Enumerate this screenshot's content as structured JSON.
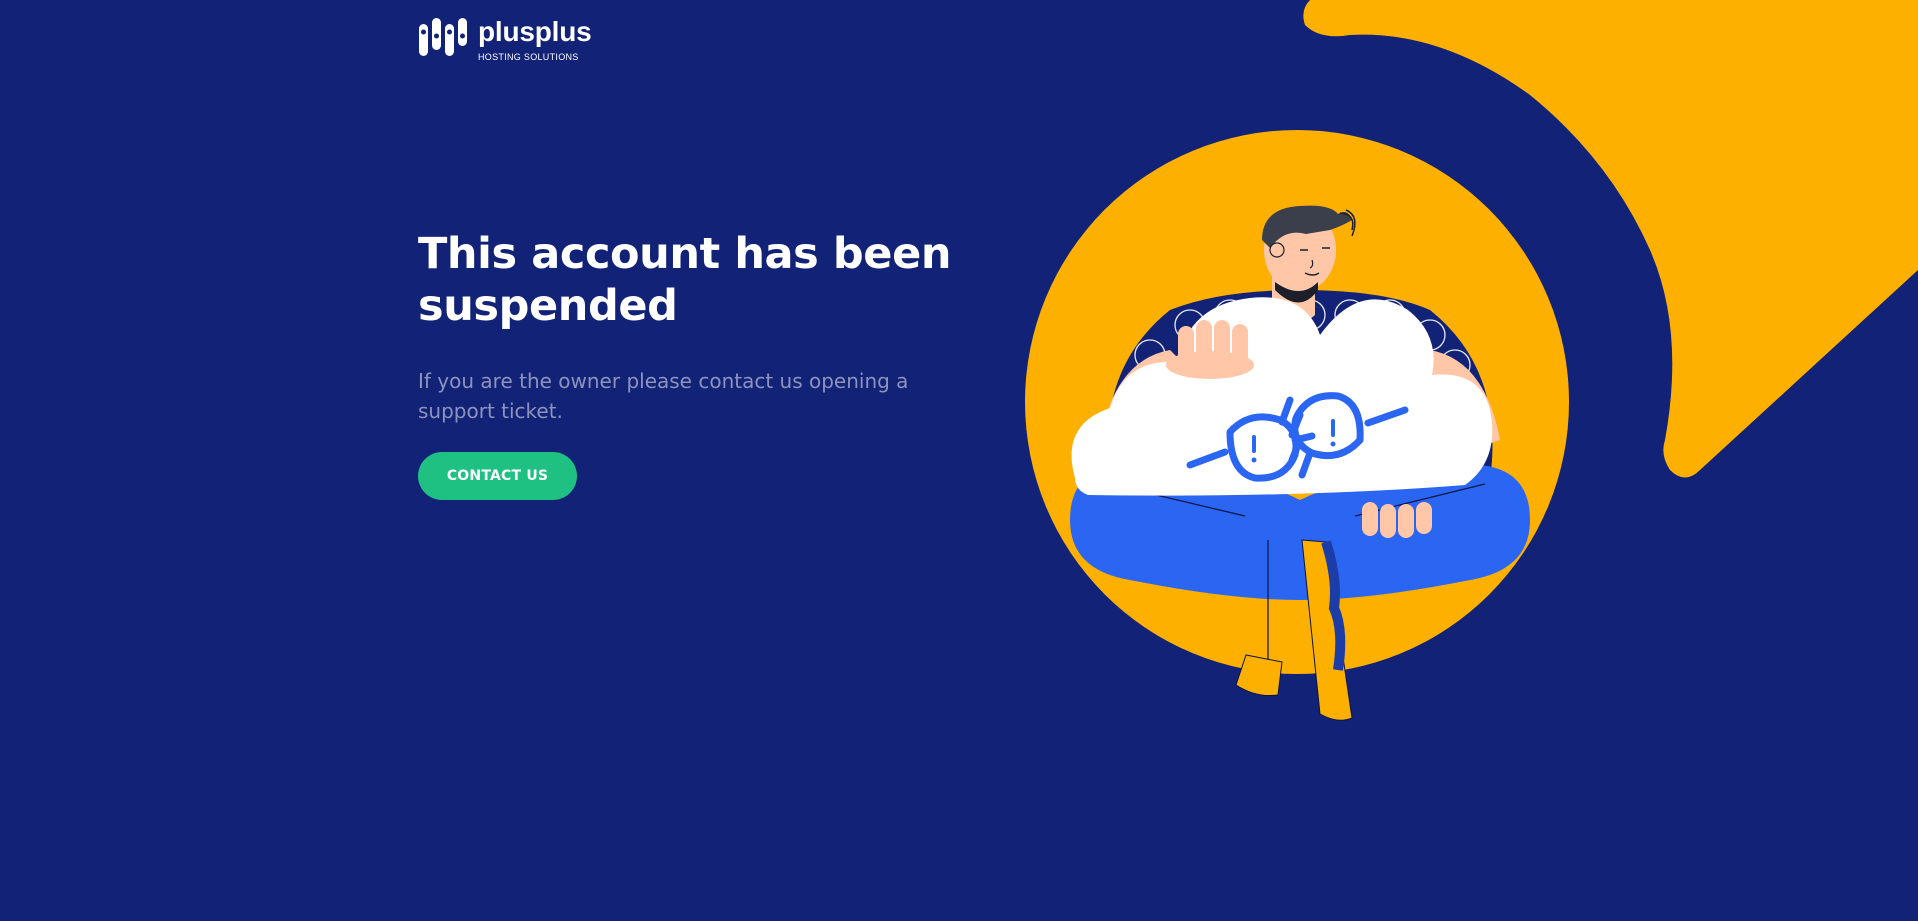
{
  "brand": {
    "name": "plusplus",
    "tagline": "HOSTING SOLUTIONS"
  },
  "main": {
    "headline": "This account has been suspended",
    "subtext": "If you are the owner please contact us opening a support ticket.",
    "contact_button_label": "CONTACT US"
  },
  "colors": {
    "background": "#122277",
    "accent_yellow": "#FDB000",
    "button_green": "#1FC183",
    "pants_blue": "#2B66F2"
  },
  "illustration": {
    "icon": "unplugged-cloud-icon"
  }
}
